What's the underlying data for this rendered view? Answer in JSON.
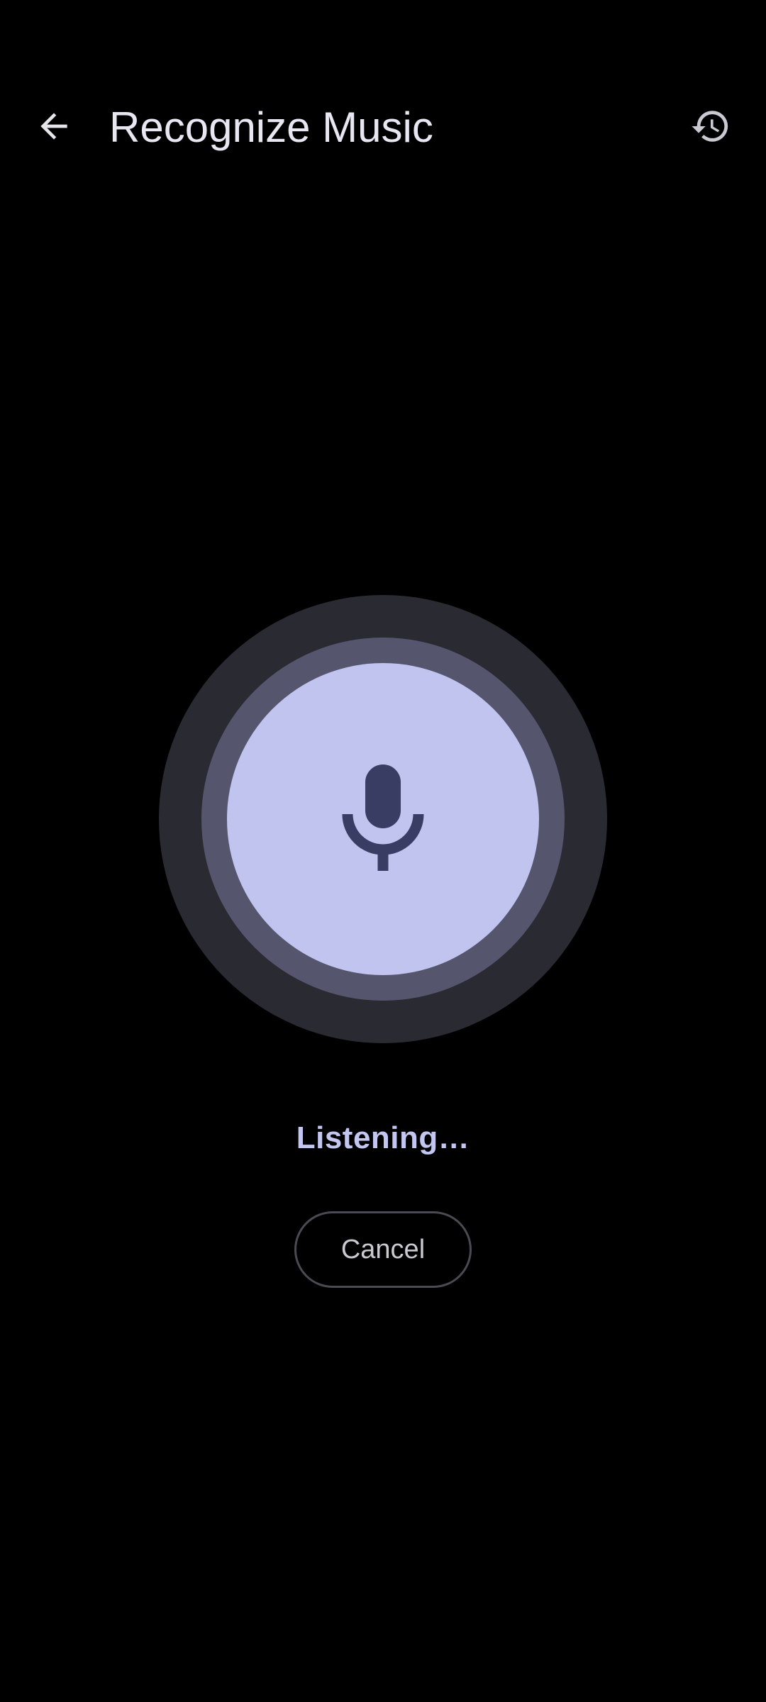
{
  "header": {
    "title": "Recognize Music",
    "back_icon": "arrow-back-icon",
    "history_icon": "history-icon"
  },
  "listening": {
    "mic_icon": "microphone-icon",
    "status": "Listening…"
  },
  "actions": {
    "cancel_label": "Cancel"
  },
  "colors": {
    "background": "#000000",
    "ring_outer": "#2A2A33",
    "ring_middle": "#55566E",
    "circle_fill": "#C0C4EE",
    "mic": "#3A3D63",
    "status_text": "#C3C6F0"
  }
}
